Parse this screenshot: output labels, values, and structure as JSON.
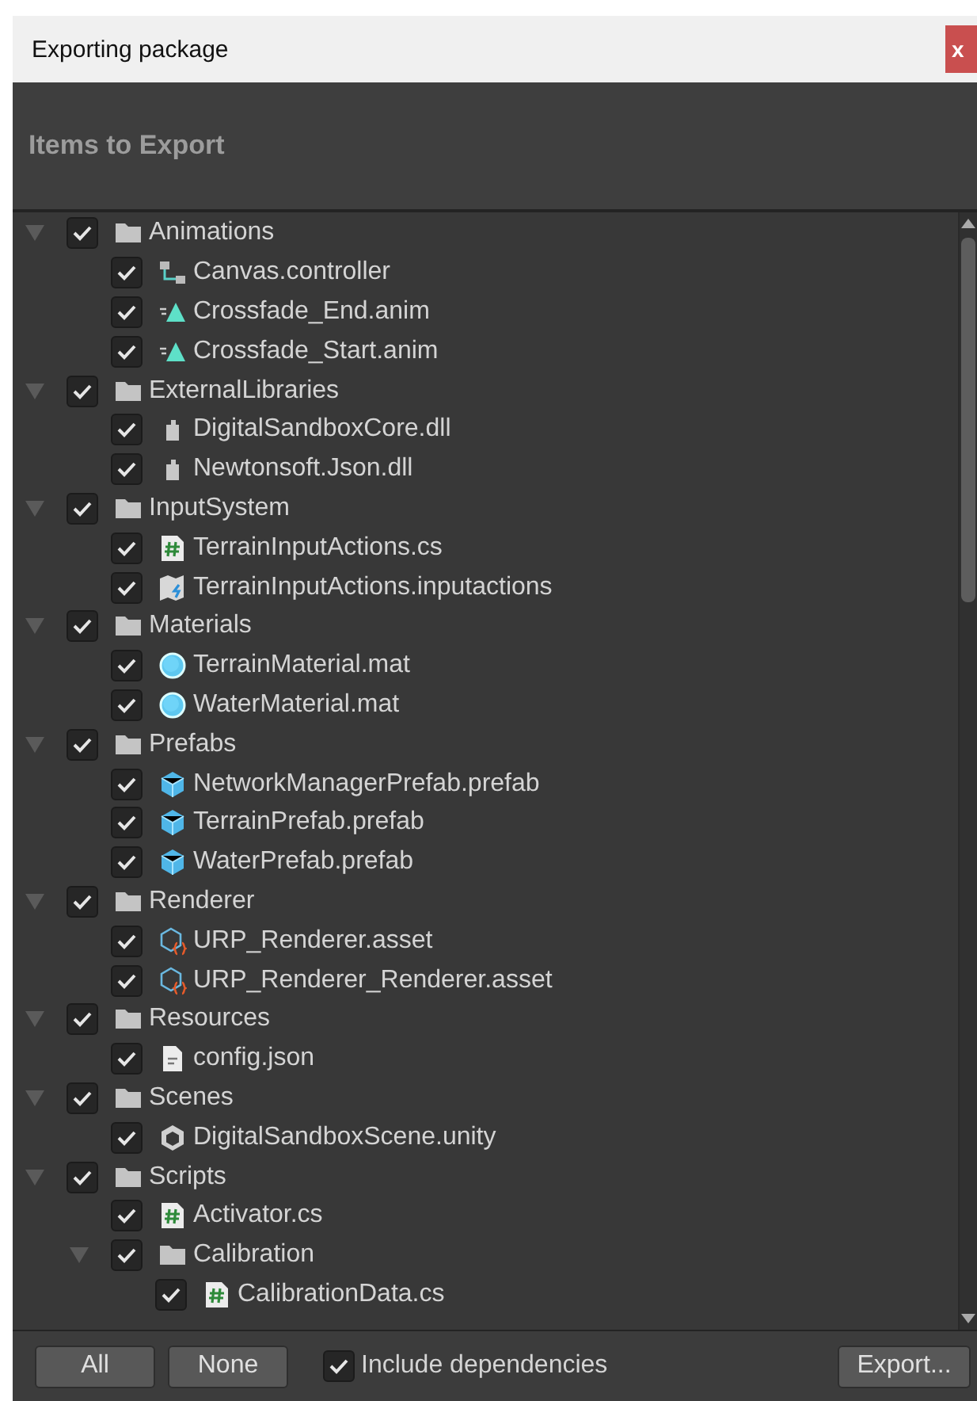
{
  "window": {
    "title": "Exporting package",
    "close": "x"
  },
  "header": {
    "title": "Items to Export"
  },
  "tree": [
    {
      "label": "Animations",
      "kind": "folder",
      "checked": true,
      "expanded": true,
      "children": [
        {
          "label": "Canvas.controller",
          "kind": "controller",
          "checked": true
        },
        {
          "label": "Crossfade_End.anim",
          "kind": "anim",
          "checked": true
        },
        {
          "label": "Crossfade_Start.anim",
          "kind": "anim",
          "checked": true
        }
      ]
    },
    {
      "label": "ExternalLibraries",
      "kind": "folder",
      "checked": true,
      "expanded": true,
      "children": [
        {
          "label": "DigitalSandboxCore.dll",
          "kind": "dll",
          "checked": true
        },
        {
          "label": "Newtonsoft.Json.dll",
          "kind": "dll",
          "checked": true
        }
      ]
    },
    {
      "label": "InputSystem",
      "kind": "folder",
      "checked": true,
      "expanded": true,
      "children": [
        {
          "label": "TerrainInputActions.cs",
          "kind": "script",
          "checked": true
        },
        {
          "label": "TerrainInputActions.inputactions",
          "kind": "inputactions",
          "checked": true
        }
      ]
    },
    {
      "label": "Materials",
      "kind": "folder",
      "checked": true,
      "expanded": true,
      "children": [
        {
          "label": "TerrainMaterial.mat",
          "kind": "material",
          "checked": true
        },
        {
          "label": "WaterMaterial.mat",
          "kind": "material",
          "checked": true
        }
      ]
    },
    {
      "label": "Prefabs",
      "kind": "folder",
      "checked": true,
      "expanded": true,
      "children": [
        {
          "label": "NetworkManagerPrefab.prefab",
          "kind": "prefab",
          "checked": true
        },
        {
          "label": "TerrainPrefab.prefab",
          "kind": "prefab",
          "checked": true
        },
        {
          "label": "WaterPrefab.prefab",
          "kind": "prefab",
          "checked": true
        }
      ]
    },
    {
      "label": "Renderer",
      "kind": "folder",
      "checked": true,
      "expanded": true,
      "children": [
        {
          "label": "URP_Renderer.asset",
          "kind": "asset",
          "checked": true
        },
        {
          "label": "URP_Renderer_Renderer.asset",
          "kind": "asset",
          "checked": true
        }
      ]
    },
    {
      "label": "Resources",
      "kind": "folder",
      "checked": true,
      "expanded": true,
      "children": [
        {
          "label": "config.json",
          "kind": "text",
          "checked": true
        }
      ]
    },
    {
      "label": "Scenes",
      "kind": "folder",
      "checked": true,
      "expanded": true,
      "children": [
        {
          "label": "DigitalSandboxScene.unity",
          "kind": "scene",
          "checked": true
        }
      ]
    },
    {
      "label": "Scripts",
      "kind": "folder",
      "checked": true,
      "expanded": true,
      "children": [
        {
          "label": "Activator.cs",
          "kind": "script",
          "checked": true
        },
        {
          "label": "Calibration",
          "kind": "folder",
          "checked": true,
          "expanded": true,
          "children": [
            {
              "label": "CalibrationData.cs",
              "kind": "script",
              "checked": true
            }
          ]
        }
      ]
    }
  ],
  "footer": {
    "all": "All",
    "none": "None",
    "include_dependencies": {
      "label": "Include dependencies",
      "checked": true
    },
    "export": "Export..."
  }
}
